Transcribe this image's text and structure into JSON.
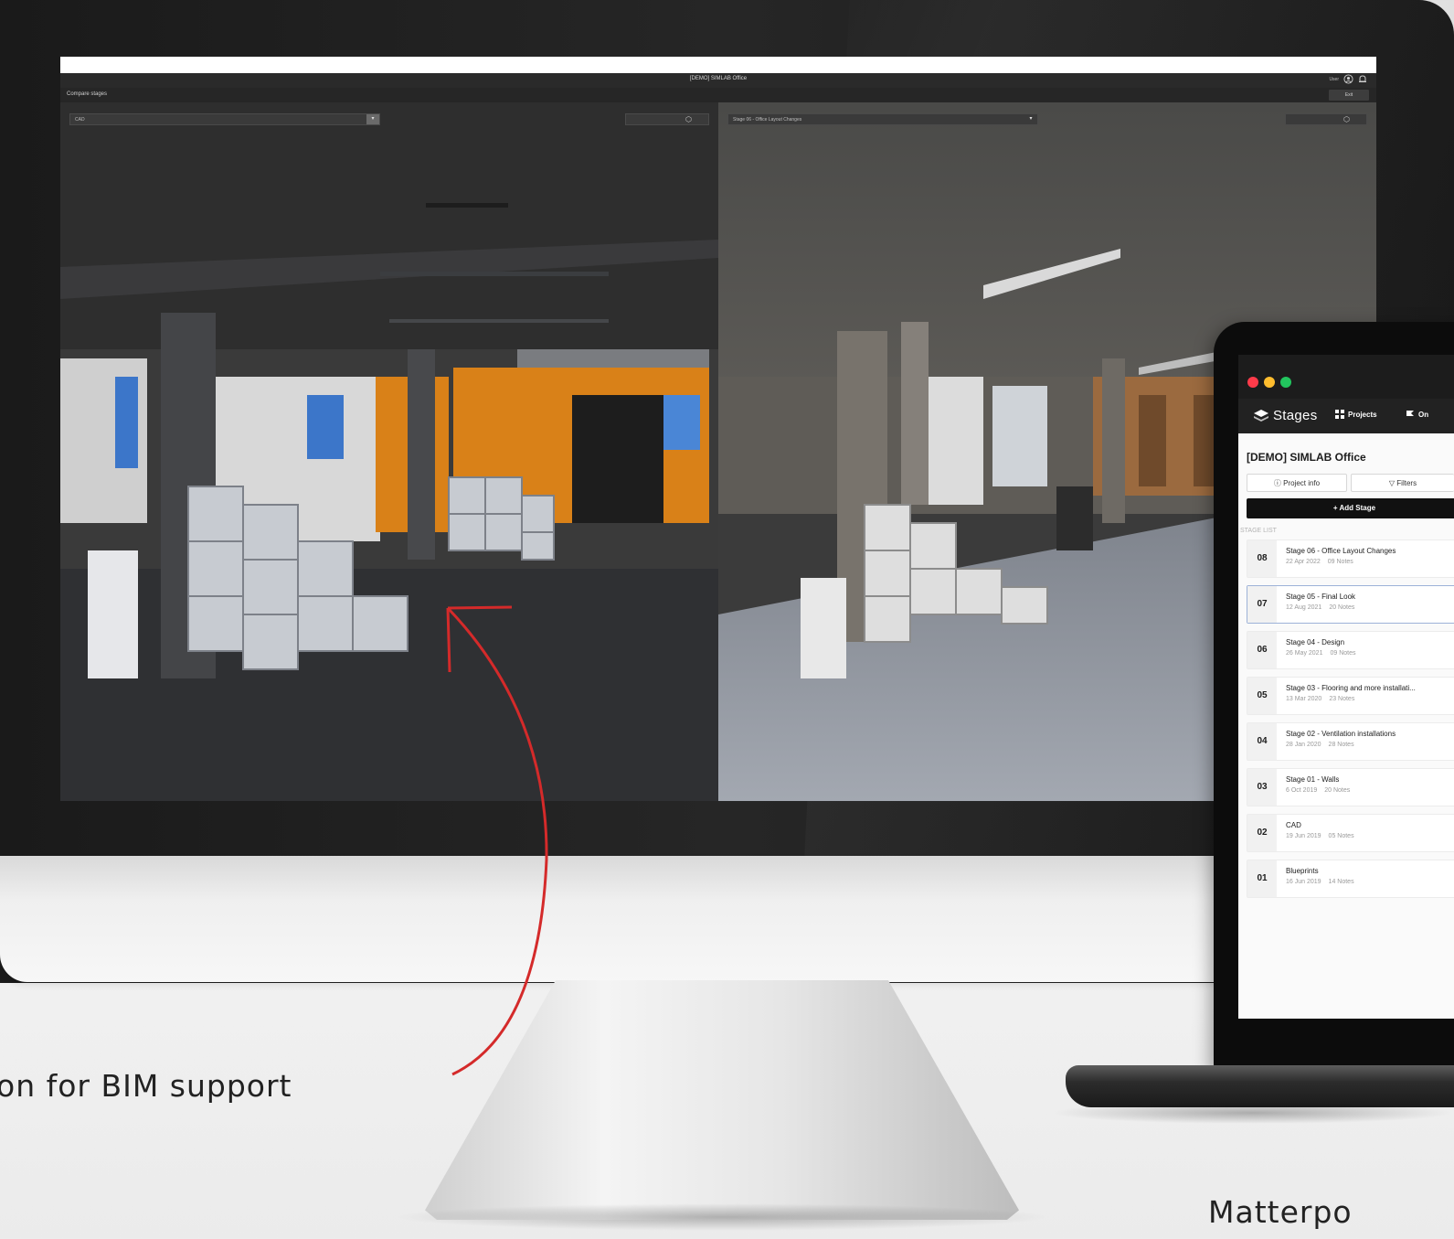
{
  "desktop_app": {
    "window_title": "[DEMO] SIMLAB Office",
    "user_label": "User",
    "compare_title": "Compare stages",
    "exit_label": "Exit",
    "left_select_value": "CAD",
    "right_select_value": "Stage 06 - Office Layout Changes"
  },
  "laptop_app": {
    "brand": "Stages",
    "nav": {
      "projects": "Projects",
      "third_item": "On"
    },
    "project_title": "[DEMO] SIMLAB Office",
    "project_info_label": "Project info",
    "filters_label": "Filters",
    "add_stage_label": "+ Add Stage",
    "stage_list_label": "STAGE LIST",
    "stages": [
      {
        "number": "08",
        "name": "Stage 06 - Office Layout Changes",
        "date": "22 Apr 2022",
        "notes": "09 Notes"
      },
      {
        "number": "07",
        "name": "Stage 05 - Final Look",
        "date": "12 Aug 2021",
        "notes": "20 Notes"
      },
      {
        "number": "06",
        "name": "Stage 04 - Design",
        "date": "26 May 2021",
        "notes": "09 Notes"
      },
      {
        "number": "05",
        "name": "Stage 03 - Flooring and more installati...",
        "date": "13 Mar 2020",
        "notes": "23 Notes"
      },
      {
        "number": "04",
        "name": "Stage 02 - Ventilation installations",
        "date": "28 Jan 2020",
        "notes": "28 Notes"
      },
      {
        "number": "03",
        "name": "Stage 01 - Walls",
        "date": "6 Oct 2019",
        "notes": "20 Notes"
      },
      {
        "number": "02",
        "name": "CAD",
        "date": "19 Jun 2019",
        "notes": "05 Notes"
      },
      {
        "number": "01",
        "name": "Blueprints",
        "date": "16 Jun 2019",
        "notes": "14 Notes"
      }
    ],
    "colors": {
      "traffic_red": "#ff3b4a",
      "traffic_yellow": "#ffbd2e",
      "traffic_green": "#22c55e",
      "selected_border": "#9db2d8"
    }
  },
  "annotations": {
    "left_caption": "on for BIM support",
    "right_caption": "Matterpo",
    "arrow_color": "#d42a2a"
  },
  "icons": [
    "cube-icon",
    "chevron-down-icon",
    "user-icon",
    "bell-icon",
    "stages-logo-icon",
    "grid-icon",
    "flag-icon",
    "info-icon",
    "filter-icon"
  ]
}
